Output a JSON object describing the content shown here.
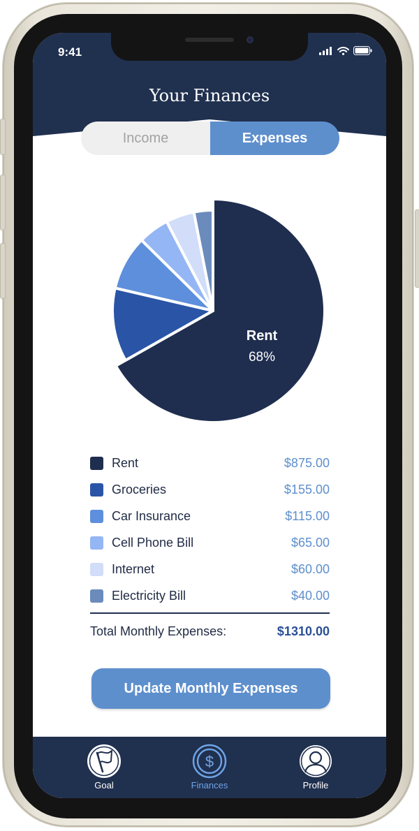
{
  "status_bar": {
    "time": "9:41"
  },
  "header": {
    "title": "Your Finances"
  },
  "segment": {
    "income_label": "Income",
    "expenses_label": "Expenses",
    "selected": "Expenses"
  },
  "chart_data": {
    "type": "pie",
    "title": "",
    "center_label": {
      "name": "Rent",
      "percent": "68%"
    },
    "categories": [
      "Rent",
      "Groceries",
      "Car Insurance",
      "Cell Phone Bill",
      "Internet",
      "Electricity Bill"
    ],
    "values": [
      875,
      155,
      115,
      65,
      60,
      40
    ],
    "colors": [
      "#1f2e4f",
      "#2a55a6",
      "#5e8fdc",
      "#94b6f4",
      "#d1ddf9",
      "#6a8bbc"
    ]
  },
  "legend": {
    "items": [
      {
        "label": "Rent",
        "amount": "$875.00",
        "color": "#1f2e4f"
      },
      {
        "label": "Groceries",
        "amount": "$155.00",
        "color": "#2a55a6"
      },
      {
        "label": "Car Insurance",
        "amount": "$115.00",
        "color": "#5e8fdc"
      },
      {
        "label": "Cell Phone Bill",
        "amount": "$65.00",
        "color": "#94b6f4"
      },
      {
        "label": "Internet",
        "amount": "$60.00",
        "color": "#d1ddf9"
      },
      {
        "label": "Electricity Bill",
        "amount": "$40.00",
        "color": "#6a8bbc"
      }
    ]
  },
  "total": {
    "label": "Total Monthly Expenses:",
    "value": "$1310.00"
  },
  "cta": {
    "label": "Update Monthly Expenses"
  },
  "tabbar": {
    "items": [
      {
        "label": "Goal",
        "icon": "flag-icon"
      },
      {
        "label": "Finances",
        "icon": "dollar-icon",
        "active": true
      },
      {
        "label": "Profile",
        "icon": "person-icon"
      }
    ]
  },
  "colors": {
    "navy": "#20304f",
    "accent": "#5e8fcd",
    "active_tab": "#6fa4e6"
  }
}
